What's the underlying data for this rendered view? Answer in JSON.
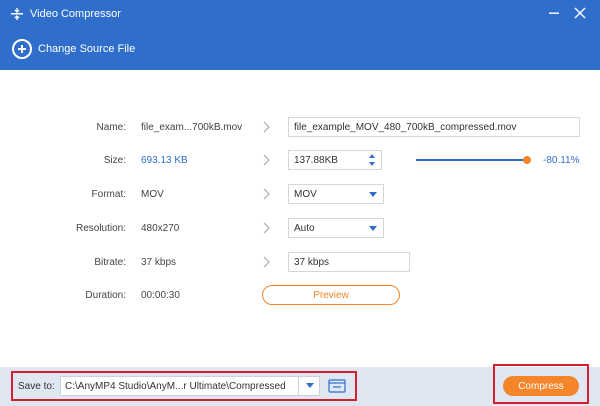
{
  "window": {
    "title": "Video Compressor"
  },
  "toolbar": {
    "change_source_label": "Change Source File"
  },
  "rows": {
    "name": {
      "label": "Name:",
      "original": "file_exam...700kB.mov",
      "output": "file_example_MOV_480_700kB_compressed.mov"
    },
    "size": {
      "label": "Size:",
      "original": "693.13 KB",
      "output": "137.88KB",
      "percent": "-80.11%",
      "slider_fraction": 0.99
    },
    "format": {
      "label": "Format:",
      "original": "MOV",
      "output": "MOV"
    },
    "resolution": {
      "label": "Resolution:",
      "original": "480x270",
      "output": "Auto"
    },
    "bitrate": {
      "label": "Bitrate:",
      "original": "37 kbps",
      "output": "37 kbps"
    },
    "duration": {
      "label": "Duration:",
      "original": "00:00:30",
      "preview_label": "Preview"
    }
  },
  "footer": {
    "save_to_label": "Save to:",
    "save_path": "C:\\AnyMP4 Studio\\AnyM...r Ultimate\\Compressed",
    "compress_label": "Compress"
  },
  "colors": {
    "accent": "#2f6fcb",
    "orange": "#f5852a",
    "highlight": "#d3202a"
  }
}
